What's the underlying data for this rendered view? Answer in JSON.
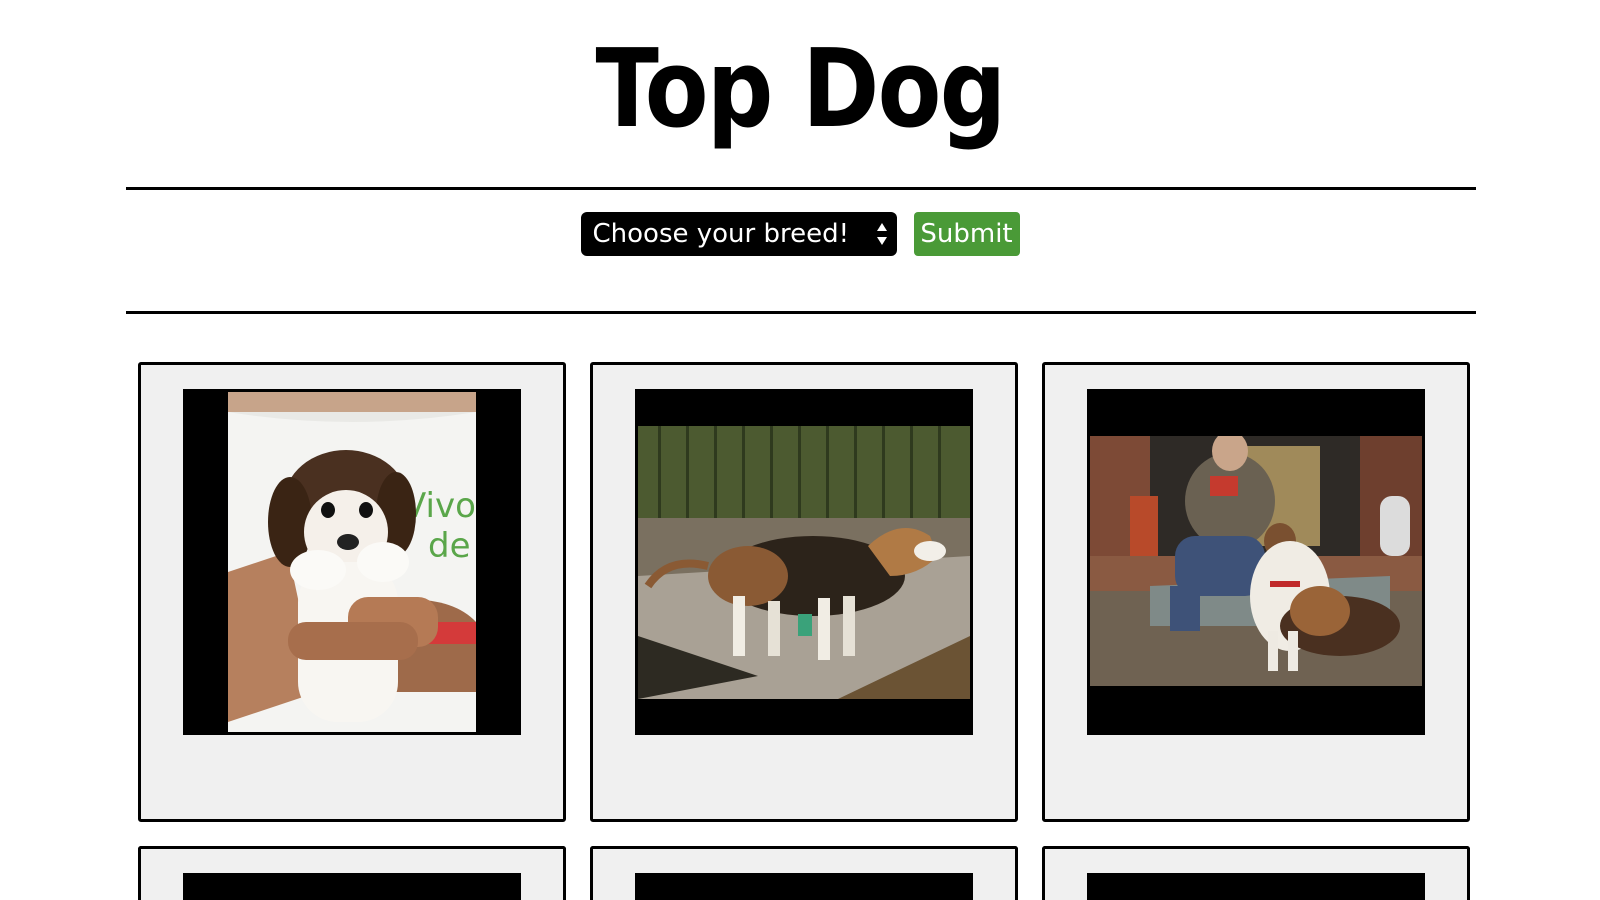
{
  "header": {
    "title": "Top Dog"
  },
  "controls": {
    "breed_select_value": "Choose your breed!",
    "submit_label": "Submit"
  },
  "gallery": {
    "cards": [
      {
        "photo": "beagle-puppy-held-photo"
      },
      {
        "photo": "beagle-by-fence-photo"
      },
      {
        "photo": "beagle-with-man-fireplace-photo"
      },
      {
        "photo": "dog-photo"
      },
      {
        "photo": "dog-photo"
      },
      {
        "photo": "dog-photo"
      }
    ]
  },
  "colors": {
    "submit_bg": "#4a9a37",
    "select_bg": "#000000",
    "card_bg": "#f0f0f0"
  }
}
